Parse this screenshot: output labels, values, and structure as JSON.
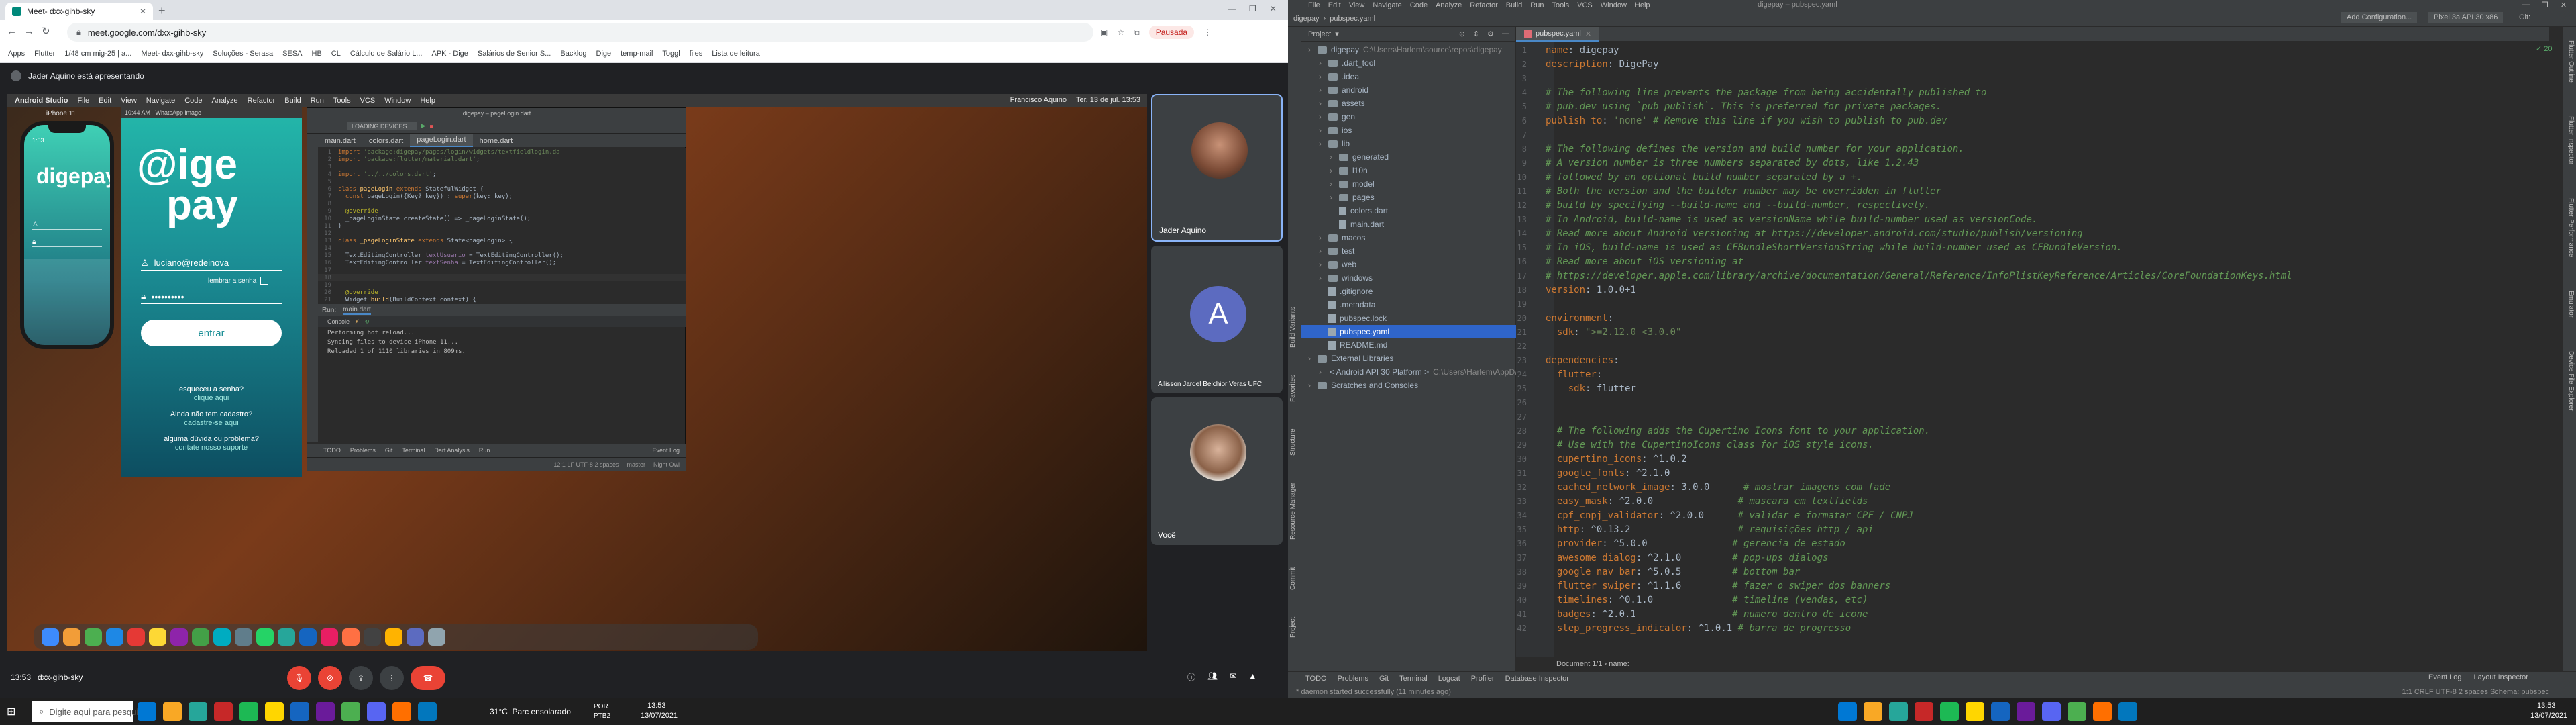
{
  "browser": {
    "tabs": [
      {
        "label": "Meet- dxx-gihb-sky"
      }
    ],
    "url": "meet.google.com/dxx-gihb-sky",
    "profile_label": "Pausada",
    "bookmarks": [
      "Apps",
      "Flutter",
      "1/48 cm mig-25 | a...",
      "Meet- dxx-gihb-sky",
      "Soluções - Serasa",
      "SESA",
      "HB",
      "CL",
      "Cálculo de Salário L...",
      "APK - Dige",
      "Salários de Senior S...",
      "Backlog",
      "Dige",
      "temp-mail",
      "Toggl",
      "files",
      "Lista de leitura"
    ]
  },
  "meet": {
    "presenting_text": "Jader Aquino está apresentando",
    "meeting_code": "dxx-gihb-sky",
    "time": "13:53",
    "participants": [
      {
        "name": "Jader Aquino"
      },
      {
        "name": "Allisson Jardel Belchior Veras UFC",
        "initial": "A"
      },
      {
        "name": "Você"
      }
    ]
  },
  "shared_screen": {
    "mac_menu": [
      "Android Studio",
      "File",
      "Edit",
      "View",
      "Navigate",
      "Code",
      "Analyze",
      "Refactor",
      "Build",
      "Run",
      "Tools",
      "VCS",
      "Window",
      "Help"
    ],
    "mac_menu_right": [
      "Francisco Aquino",
      "Ter. 13 de jul. 13:53"
    ],
    "simulator_title": "iPhone 11",
    "phone_logo": "digepay",
    "login_screen": {
      "logo_top": "@ige",
      "logo_bottom": "pay",
      "email_value": "luciano@redeinova",
      "remember_label": "lembrar a senha",
      "password_mask": "••••••••••",
      "login_button": "entrar",
      "forgot_password": "esqueceu a senha?",
      "forgot_link": "clique aqui",
      "no_account": "Ainda não tem cadastro?",
      "register_link": "cadastre-se aqui",
      "help_question": "alguma dúvida ou problema?",
      "support_link": "contate nosso suporte"
    },
    "ide_tabs": [
      "main.dart",
      "colors.dart",
      "pageLogin.dart",
      "home.dart"
    ],
    "ide_title": "digepay – pageLogin.dart",
    "code_lines": [
      {
        "n": "1",
        "html": "<span class='kw'>import</span> <span class='str'>'package:digepay/pages/login/widgets/textfieldlogin.da</span>"
      },
      {
        "n": "2",
        "html": "<span class='kw'>import</span> <span class='str'>'package:flutter/material.dart'</span>;"
      },
      {
        "n": "3",
        "html": ""
      },
      {
        "n": "4",
        "html": "<span class='kw'>import</span> <span class='str'>'../../colors.dart'</span>;"
      },
      {
        "n": "5",
        "html": ""
      },
      {
        "n": "6",
        "html": "<span class='kw'>class</span> <span class='cl'>pageLogin</span> <span class='kw'>extends</span> StatefulWidget {"
      },
      {
        "n": "7",
        "html": "  <span class='kw'>const</span> pageLogin({Key? key}) : <span class='kw'>super</span>(key: key);"
      },
      {
        "n": "8",
        "html": ""
      },
      {
        "n": "9",
        "html": "  <span class='an'>@override</span>"
      },
      {
        "n": "10",
        "html": "  _pageLoginState createState() => _pageLoginState();"
      },
      {
        "n": "11",
        "html": "}"
      },
      {
        "n": "12",
        "html": ""
      },
      {
        "n": "13",
        "html": "<span class='kw'>class</span> <span class='cl'>_pageLoginState</span> <span class='kw'>extends</span> State&lt;pageLogin&gt; {"
      },
      {
        "n": "14",
        "html": ""
      },
      {
        "n": "15",
        "html": "  TextEditingController <span class='fld'>textUsuario</span> = TextEditingController();"
      },
      {
        "n": "16",
        "html": "  TextEditingController <span class='fld'>textSenha</span> = TextEditingController();"
      },
      {
        "n": "17",
        "html": ""
      },
      {
        "n": "18",
        "html": "  |"
      },
      {
        "n": "19",
        "html": ""
      },
      {
        "n": "20",
        "html": "  <span class='an'>@override</span>"
      },
      {
        "n": "21",
        "html": "  Widget <span class='cl'>build</span>(BuildContext context) {"
      }
    ],
    "run_tab": "main.dart",
    "console_lines": [
      "Performing hot reload...",
      "Syncing files to device iPhone 11...",
      "Reloaded 1 of 1110 libraries in 809ms."
    ],
    "bottom_tabs": [
      "TODO",
      "Problems",
      "Git",
      "Terminal",
      "Dart Analysis",
      "Run"
    ],
    "status_right": [
      "Event Log"
    ],
    "status_bar": "12:1  LF  UTF-8  2 spaces",
    "branch": "master",
    "night_owl": "Night Owl"
  },
  "meet_controls": {
    "left_time": "13:53",
    "left_code": "dxx-gihb-sky"
  },
  "taskbar_left": {
    "search_placeholder": "Digite aqui para pesquisar",
    "weather": "31°C  Parc ensolarado",
    "lang": "POR\nPTB2",
    "time": "13:53",
    "date": "13/07/2021"
  },
  "ide_right": {
    "menu": [
      "File",
      "Edit",
      "View",
      "Navigate",
      "Code",
      "Analyze",
      "Refactor",
      "Build",
      "Run",
      "Tools",
      "VCS",
      "Window",
      "Help"
    ],
    "window_title": "digepay – pubspec.yaml",
    "breadcrumb": [
      "digepay",
      "pubspec.yaml"
    ],
    "run_config": "Add Configuration...",
    "device": "Pixel 3a API 30 x86",
    "git_label": "Git:",
    "project_label": "Project",
    "editor_tab": "pubspec.yaml",
    "tree": [
      {
        "depth": 0,
        "label": "digepay",
        "extra": "C:\\Users\\Harlem\\source\\repos\\digepay",
        "type": "folder"
      },
      {
        "depth": 1,
        "label": ".dart_tool",
        "type": "folder"
      },
      {
        "depth": 1,
        "label": ".idea",
        "type": "folder"
      },
      {
        "depth": 1,
        "label": "android",
        "type": "folder"
      },
      {
        "depth": 1,
        "label": "assets",
        "type": "folder"
      },
      {
        "depth": 1,
        "label": "gen",
        "type": "folder"
      },
      {
        "depth": 1,
        "label": "ios",
        "type": "folder"
      },
      {
        "depth": 1,
        "label": "lib",
        "type": "folder"
      },
      {
        "depth": 2,
        "label": "generated",
        "type": "folder"
      },
      {
        "depth": 2,
        "label": "l10n",
        "type": "folder"
      },
      {
        "depth": 2,
        "label": "model",
        "type": "folder"
      },
      {
        "depth": 2,
        "label": "pages",
        "type": "folder"
      },
      {
        "depth": 2,
        "label": "colors.dart",
        "type": "file"
      },
      {
        "depth": 2,
        "label": "main.dart",
        "type": "file"
      },
      {
        "depth": 1,
        "label": "macos",
        "type": "folder"
      },
      {
        "depth": 1,
        "label": "test",
        "type": "folder"
      },
      {
        "depth": 1,
        "label": "web",
        "type": "folder"
      },
      {
        "depth": 1,
        "label": "windows",
        "type": "folder"
      },
      {
        "depth": 1,
        "label": ".gitignore",
        "type": "file"
      },
      {
        "depth": 1,
        "label": ".metadata",
        "type": "file"
      },
      {
        "depth": 1,
        "label": "pubspec.lock",
        "type": "file"
      },
      {
        "depth": 1,
        "label": "pubspec.yaml",
        "type": "file",
        "selected": true
      },
      {
        "depth": 1,
        "label": "README.md",
        "type": "file"
      },
      {
        "depth": 0,
        "label": "External Libraries",
        "type": "folder"
      },
      {
        "depth": 1,
        "label": "< Android API 30 Platform >",
        "extra": "C:\\Users\\Harlem\\AppDa",
        "type": "folder"
      },
      {
        "depth": 0,
        "label": "Scratches and Consoles",
        "type": "folder"
      }
    ],
    "yaml": [
      {
        "n": "1",
        "html": "<span class='yk'>name</span>: digepay"
      },
      {
        "n": "2",
        "html": "<span class='yk'>description</span>: DigePay"
      },
      {
        "n": "3",
        "html": ""
      },
      {
        "n": "4",
        "html": "<span class='yc'># The following line prevents the package from being accidentally published to</span>"
      },
      {
        "n": "5",
        "html": "<span class='yc'># pub.dev using `pub publish`. This is preferred for private packages.</span>"
      },
      {
        "n": "6",
        "html": "<span class='yk'>publish_to</span>: <span class='str'>'none'</span> <span class='yc'># Remove this line if you wish to publish to pub.dev</span>"
      },
      {
        "n": "7",
        "html": ""
      },
      {
        "n": "8",
        "html": "<span class='yc'># The following defines the version and build number for your application.</span>"
      },
      {
        "n": "9",
        "html": "<span class='yc'># A version number is three numbers separated by dots, like 1.2.43</span>"
      },
      {
        "n": "10",
        "html": "<span class='yc'># followed by an optional build number separated by a +.</span>"
      },
      {
        "n": "11",
        "html": "<span class='yc'># Both the version and the builder number may be overridden in flutter</span>"
      },
      {
        "n": "12",
        "html": "<span class='yc'># build by specifying --build-name and --build-number, respectively.</span>"
      },
      {
        "n": "13",
        "html": "<span class='yc'># In Android, build-name is used as versionName while build-number used as versionCode.</span>"
      },
      {
        "n": "14",
        "html": "<span class='yc'># Read more about Android versioning at https://developer.android.com/studio/publish/versioning</span>"
      },
      {
        "n": "15",
        "html": "<span class='yc'># In iOS, build-name is used as CFBundleShortVersionString while build-number used as CFBundleVersion.</span>"
      },
      {
        "n": "16",
        "html": "<span class='yc'># Read more about iOS versioning at</span>"
      },
      {
        "n": "17",
        "html": "<span class='yc'># https://developer.apple.com/library/archive/documentation/General/Reference/InfoPlistKeyReference/Articles/CoreFoundationKeys.html</span>"
      },
      {
        "n": "18",
        "html": "<span class='yk'>version</span>: 1.0.0+1"
      },
      {
        "n": "19",
        "html": ""
      },
      {
        "n": "20",
        "html": "<span class='yk'>environment</span>:"
      },
      {
        "n": "21",
        "html": "  <span class='yk'>sdk</span>: <span class='str'>\">=2.12.0 <3.0.0\"</span>"
      },
      {
        "n": "22",
        "html": ""
      },
      {
        "n": "23",
        "html": "<span class='yk'>dependencies</span>:"
      },
      {
        "n": "24",
        "html": "  <span class='yk'>flutter</span>:"
      },
      {
        "n": "25",
        "html": "    <span class='yk'>sdk</span>: flutter"
      },
      {
        "n": "26",
        "html": ""
      },
      {
        "n": "27",
        "html": ""
      },
      {
        "n": "28",
        "html": "  <span class='yc'># The following adds the Cupertino Icons font to your application.</span>"
      },
      {
        "n": "29",
        "html": "  <span class='yc'># Use with the CupertinoIcons class for iOS style icons.</span>"
      },
      {
        "n": "30",
        "html": "  <span class='yk'>cupertino_icons</span>: ^1.0.2"
      },
      {
        "n": "31",
        "html": "  <span class='yk'>google_fonts</span>: ^2.1.0"
      },
      {
        "n": "32",
        "html": "  <span class='yk'>cached_network_image</span>: 3.0.0      <span class='yc'># mostrar imagens com fade</span>"
      },
      {
        "n": "33",
        "html": "  <span class='yk'>easy_mask</span>: ^2.0.0               <span class='yc'># mascara em textfields</span>"
      },
      {
        "n": "34",
        "html": "  <span class='yk'>cpf_cnpj_validator</span>: ^2.0.0      <span class='yc'># validar e formatar CPF / CNPJ</span>"
      },
      {
        "n": "35",
        "html": "  <span class='yk'>http</span>: ^0.13.2                   <span class='yc'># requisições http / api</span>"
      },
      {
        "n": "36",
        "html": "  <span class='yk'>provider</span>: ^5.0.0               <span class='yc'># gerencia de estado</span>"
      },
      {
        "n": "37",
        "html": "  <span class='yk'>awesome_dialog</span>: ^2.1.0         <span class='yc'># pop-ups dialogs</span>"
      },
      {
        "n": "38",
        "html": "  <span class='yk'>google_nav_bar</span>: ^5.0.5         <span class='yc'># bottom bar</span>"
      },
      {
        "n": "39",
        "html": "  <span class='yk'>flutter_swiper</span>: ^1.1.6         <span class='yc'># fazer o swiper dos banners</span>"
      },
      {
        "n": "40",
        "html": "  <span class='yk'>timelines</span>: ^0.1.0              <span class='yc'># timeline (vendas, etc)</span>"
      },
      {
        "n": "41",
        "html": "  <span class='yk'>badges</span>: ^2.0.1                 <span class='yc'># numero dentro de icone</span>"
      },
      {
        "n": "42",
        "html": "  <span class='yk'>step_progress_indicator</span>: ^1.0.1 <span class='yc'># barra de progresso</span>"
      }
    ],
    "doc_crumb": "Document 1/1  ›  name:",
    "bottom_tabs": [
      "TODO",
      "Problems",
      "Git",
      "Terminal",
      "Logcat",
      "Profiler",
      "Database Inspector"
    ],
    "bottom_right": [
      "Event Log",
      "Layout Inspector"
    ],
    "status_msg": "* daemon started successfully (11 minutes ago)",
    "status_right": "1:1  CRLF  UTF-8  2 spaces  Schema: pubspec",
    "side_tabs_left": [
      "Project",
      "Commit",
      "Resource Manager",
      "Structure",
      "Favorites",
      "Build Variants"
    ],
    "side_tabs_right": [
      "Flutter Outline",
      "Flutter Inspector",
      "Flutter Performance",
      "Emulator",
      "Device File Explorer"
    ]
  },
  "taskbar_right": {
    "time": "13:53",
    "date": "13/07/2021"
  },
  "colors": {
    "meet_bg": "#202124",
    "ide_bg": "#2b2b2b",
    "teal": "#23a9a0",
    "accent_blue": "#1a73e8",
    "red_end_call": "#ea4335"
  }
}
